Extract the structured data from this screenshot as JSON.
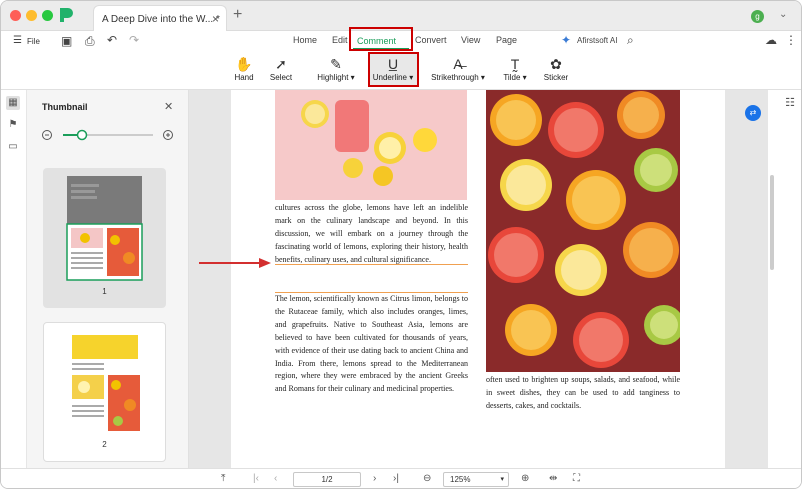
{
  "tab": {
    "title": "A Deep Dive into the W...",
    "modified": "*"
  },
  "avatar_letter": "g",
  "menubar": {
    "file": "File",
    "items": [
      "Home",
      "Edit",
      "Comment",
      "Convert",
      "View",
      "Page"
    ],
    "ai": "Afirstsoft AI"
  },
  "toolbar": {
    "tools": [
      "Hand",
      "Select",
      "Highlight",
      "Underline",
      "Strikethrough",
      "Tilde",
      "Sticker"
    ]
  },
  "panel": {
    "title": "Thumbnail",
    "pages": [
      "1",
      "2"
    ]
  },
  "document": {
    "para1": "cultures across the globe, lemons have left an indelible mark on the culinary landscape and beyond. In this discussion, we will embark on a journey through the fascinating world of lemons, exploring their history, health benefits, culinary uses, and cultural significance.",
    "para2": "The lemon, scientifically known as Citrus limon, belongs to the Rutaceae family, which also includes oranges, limes, and grapefruits. Native to Southeast Asia, lemons are believed to have been cultivated for thousands of years, with evidence of their use dating back to ancient China and India. From there, lemons spread to the Mediterranean region, where they were embraced by the ancient Greeks and Romans for their culinary and medicinal properties.",
    "para3": "often used to brighten up soups, salads, and seafood, while in sweet dishes, they can be used to add tanginess to desserts, cakes, and cocktails."
  },
  "bottombar": {
    "page": "1/2",
    "zoom": "125%"
  },
  "colors": {
    "accent": "#1b9e5a",
    "highlight_box": "#cc0000"
  }
}
